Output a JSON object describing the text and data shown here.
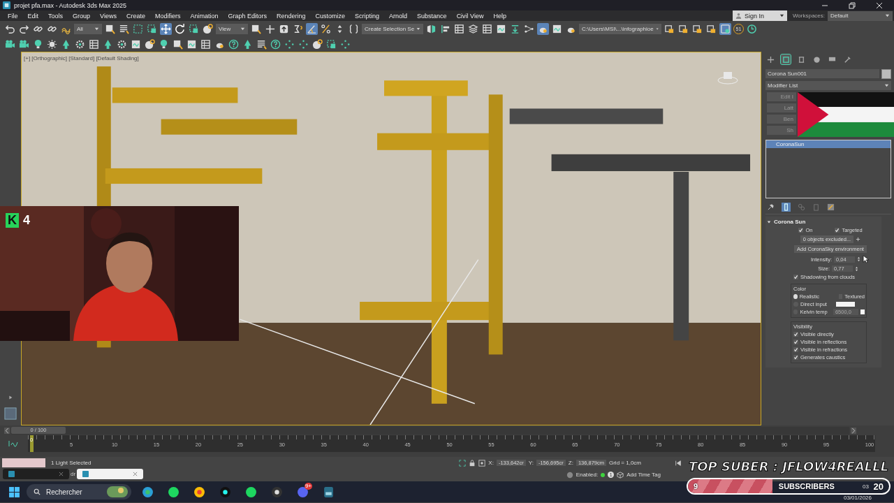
{
  "window": {
    "title": "projet pfa.max - Autodesk 3ds Max 2025"
  },
  "menu": [
    "File",
    "Edit",
    "Tools",
    "Group",
    "Views",
    "Create",
    "Modifiers",
    "Animation",
    "Graph Editors",
    "Rendering",
    "Customize",
    "Scripting",
    "Arnold",
    "Substance",
    "Civil View",
    "Help"
  ],
  "account": {
    "sign_in": "Sign In",
    "workspaces_label": "Workspaces:",
    "workspace": "Default"
  },
  "toolbar": {
    "selection_filter": "All",
    "reference_coord": "View",
    "selection_set": "Create Selection Se",
    "project_path": "C:\\Users\\MSI\\...\\infographioe",
    "snap_count": "51"
  },
  "viewport": {
    "label": "[+] [Orthographic] [Standard] [Default Shading]"
  },
  "webcam": {
    "badge_letter": "K",
    "badge_count": "4"
  },
  "command_panel": {
    "tabs": [
      {
        "selected": false
      },
      {
        "selected": true
      },
      {
        "selected": false
      },
      {
        "selected": false
      },
      {
        "selected": false
      },
      {
        "selected": false
      }
    ],
    "object_name": "Corona Sun001",
    "modifier_list": "Modifier List",
    "modifier_buttons": [
      "Edit I",
      "Latt",
      "Ben",
      "Sh"
    ],
    "stack": [
      {
        "label": "CoronaSun",
        "selected": true
      }
    ],
    "rollout": {
      "title": "Corona Sun",
      "on": {
        "label": "On",
        "checked": true
      },
      "targeted": {
        "label": "Targeted",
        "checked": true
      },
      "excluded": "0 objects excluded...",
      "add_sky": "Add CoronaSky environment",
      "intensity": {
        "label": "Intensity:",
        "value": "0,04"
      },
      "size": {
        "label": "Size:",
        "value": "0,77"
      },
      "shadowing": {
        "label": "Shadowing from clouds",
        "checked": true
      },
      "color": {
        "title": "Color",
        "options": [
          {
            "label": "Realistic",
            "selected": true
          },
          {
            "label": "Direct input",
            "selected": false
          },
          {
            "label": "Kelvin temp",
            "selected": false
          }
        ],
        "textured": {
          "label": "Textured",
          "checked": false
        },
        "kelvin_value": "6500,0"
      },
      "visibility": {
        "title": "Visibility",
        "options": [
          {
            "label": "Visible directly",
            "checked": true
          },
          {
            "label": "Visible in reflections",
            "checked": true
          },
          {
            "label": "Visible in refractions",
            "checked": true
          },
          {
            "label": "Generates caustics",
            "checked": true
          }
        ]
      }
    }
  },
  "timeline": {
    "frame": "0 / 100",
    "level": 0,
    "ticks": [
      "0",
      "5",
      "10",
      "15",
      "20",
      "25",
      "30",
      "35",
      "40",
      "45",
      "50",
      "55",
      "60",
      "65",
      "70",
      "75",
      "80",
      "85",
      "90",
      "95",
      "100"
    ]
  },
  "status": {
    "selection": "1 Light Selected",
    "x_label": "X:",
    "x": "-133,642cr",
    "y_label": "Y:",
    "y": "-156,695cr",
    "z_label": "Z:",
    "z": "136,879cm",
    "grid": "Grid = 1,0cm",
    "enabled": "Enabled:",
    "enabled_count": "1",
    "time_tag": "Add Time Tag"
  },
  "thumbnails": {
    "text": "dr"
  },
  "overlay": {
    "top_suber": "TOP SUBER : JFLOW4REALLL",
    "subscribers": {
      "count": "9",
      "label": "SUBSCRIBERS",
      "goal": "20",
      "level": 0.42
    }
  },
  "taskbar": {
    "search": "Rechercher",
    "chat_badge": "9+",
    "clock_time": "03",
    "clock_date": "03/01/2026"
  }
}
